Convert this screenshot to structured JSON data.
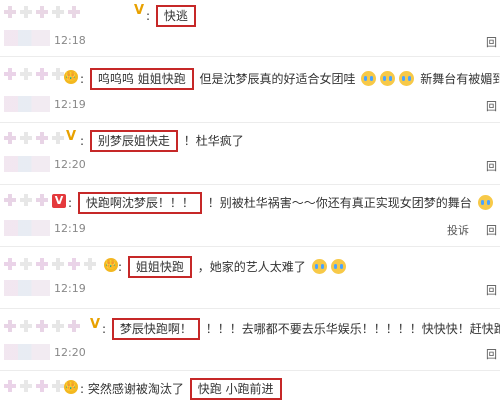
{
  "comments": [
    {
      "badge": "V",
      "segments": {
        "pre": "",
        "box": "快逃",
        "post": ""
      },
      "time": "12:18",
      "actions": [
        "回"
      ]
    },
    {
      "badge": "👑",
      "segments": {
        "pre": "",
        "box": "呜呜呜 姐姐快跑",
        "post": "但是沈梦辰真的好适合女团哇",
        "tail": "新舞台有被媚到"
      },
      "time": "12:19",
      "actions": [
        "回"
      ]
    },
    {
      "badge": "V",
      "segments": {
        "pre": "",
        "box": "别梦辰姐快走",
        "post": "！杜华疯了"
      },
      "time": "12:20",
      "actions": [
        "回"
      ]
    },
    {
      "badge": "V",
      "segments": {
        "pre": "",
        "box": "快跑啊沈梦辰！！！",
        "post": "！别被杜华祸害～～你还有真正实现女团梦的舞台"
      },
      "time": "12:19",
      "actions": [
        "投诉",
        "回"
      ]
    },
    {
      "badge": "👑",
      "segments": {
        "pre": "",
        "box": "姐姐快跑",
        "post": "，她家的艺人太难了"
      },
      "time": "12:19",
      "actions": [
        "回"
      ]
    },
    {
      "badge": "V",
      "segments": {
        "pre": "",
        "box": "梦辰快跑啊！",
        "post": "！！！去哪都不要去乐华娱乐！！！！！快快快！赶快跑"
      },
      "time": "12:20",
      "actions": [
        "回"
      ]
    },
    {
      "badge": "👑",
      "segments": {
        "pre": "突然感谢被淘汰了",
        "box": "快跑 小跑前进",
        "post": ""
      },
      "time": "",
      "actions": []
    }
  ],
  "colors": {
    "highlight": "#c62828",
    "timestamp": "#888888"
  },
  "icons": {
    "crying": "crying-emoji-icon",
    "wink": "wink-emoji-icon"
  }
}
